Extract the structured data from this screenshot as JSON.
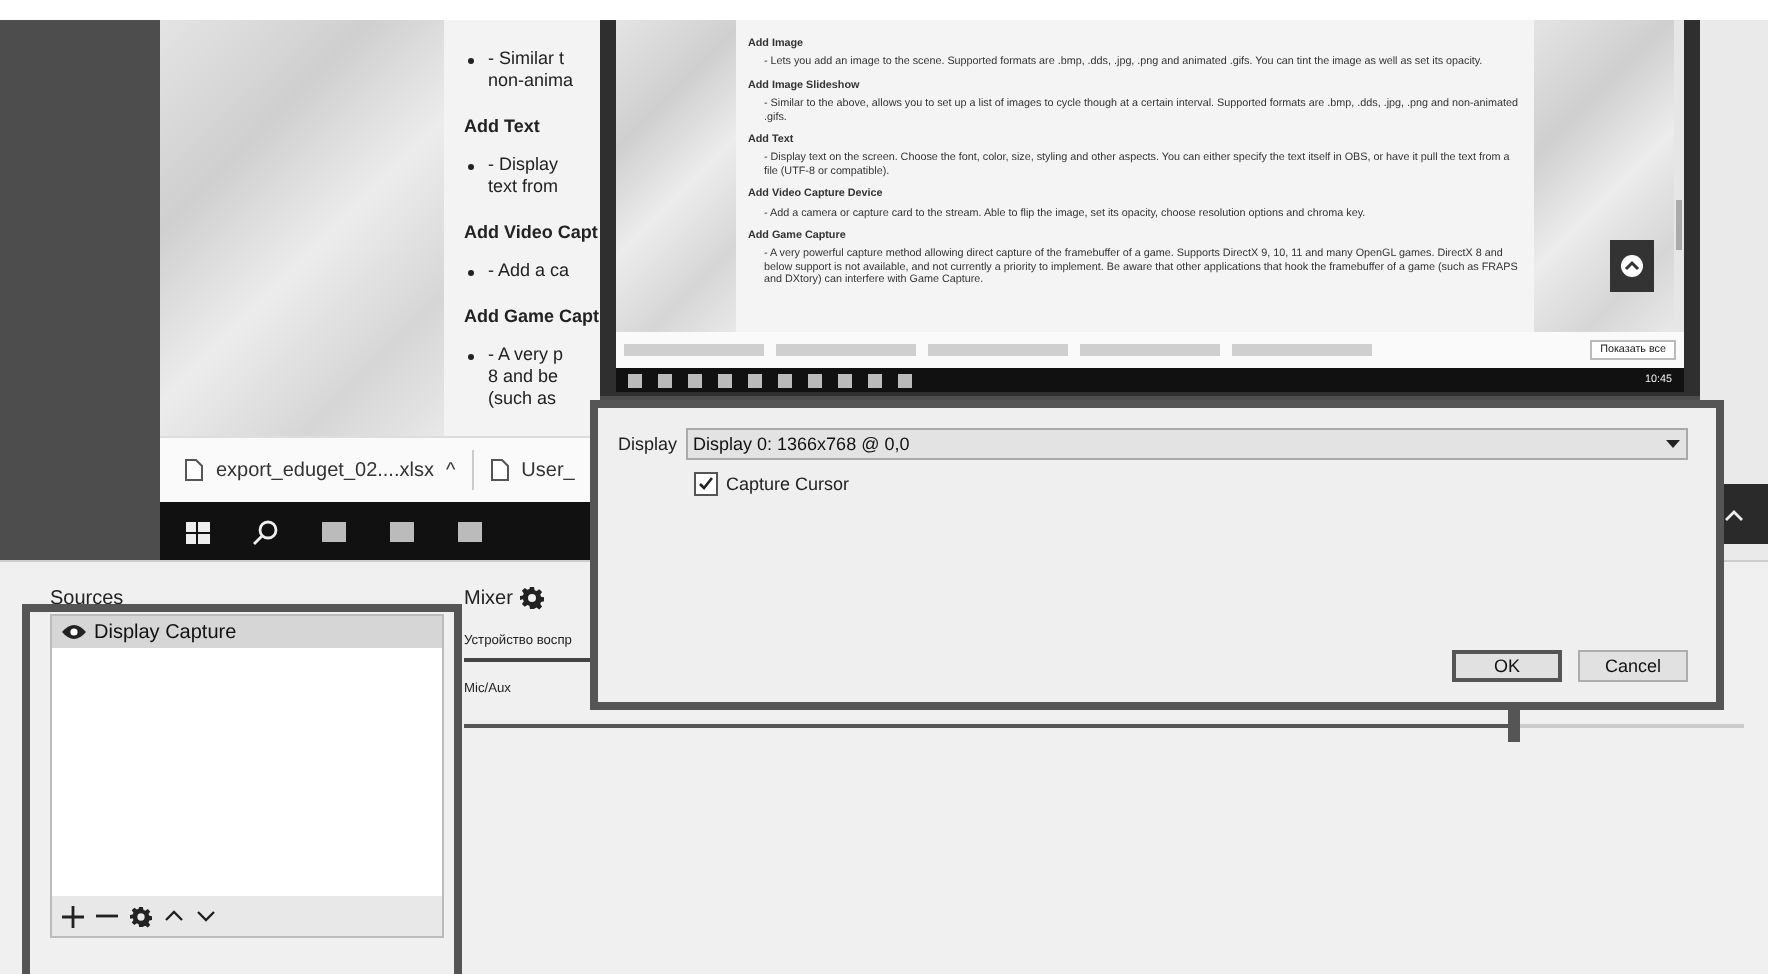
{
  "outer_page": {
    "lines": [
      {
        "kind": "bullet",
        "text": "- Similar t"
      },
      {
        "kind": "cont",
        "text": "non-anima"
      },
      {
        "kind": "heading",
        "text": "Add Text"
      },
      {
        "kind": "bullet",
        "text": "- Display"
      },
      {
        "kind": "cont",
        "text": "text from"
      },
      {
        "kind": "heading",
        "text": "Add Video Capt"
      },
      {
        "kind": "bullet",
        "text": "- Add a ca"
      },
      {
        "kind": "heading",
        "text": "Add Game Capt"
      },
      {
        "kind": "bullet",
        "text": "- A very p"
      },
      {
        "kind": "cont",
        "text": "8 and be"
      },
      {
        "kind": "cont",
        "text": "(such as"
      }
    ]
  },
  "outer_downloads": [
    {
      "name": "export_eduget_02....xlsx",
      "caret": "^"
    },
    {
      "name": "User_"
    }
  ],
  "preview_page": {
    "sections": [
      {
        "heading": "Add Image",
        "text": "- Lets you add an image to the scene. Supported formats are .bmp, .dds, .jpg, .png and animated .gifs. You can tint the image as well as set its opacity."
      },
      {
        "heading": "Add Image Slideshow",
        "text": "- Similar to the above, allows you to set up a list of images to cycle though at a certain interval. Supported formats are .bmp, .dds, .jpg, .png and non-animated .gifs."
      },
      {
        "heading": "Add Text",
        "text": "- Display text on the screen. Choose the font, color, size, styling and other aspects. You can either specify the text itself in OBS, or have it pull the text from a file (UTF-8 or compatible)."
      },
      {
        "heading": "Add Video Capture Device",
        "text": "- Add a camera or capture card to the stream. Able to flip the image, set its opacity, choose resolution options and chroma key."
      },
      {
        "heading": "Add Game Capture",
        "text": "- A very powerful capture method allowing direct capture of the framebuffer of a game. Supports DirectX 9, 10, 11 and many OpenGL games. DirectX 8 and below support is not available, and not currently a priority to implement. Be aware that other applications that hook the framebuffer of a game (such as FRAPS and DXtory) can interfere with Game Capture."
      }
    ],
    "show_all": "Показать все",
    "clock": "10:45"
  },
  "dialog": {
    "display_label": "Display",
    "display_value": "Display 0: 1366x768 @ 0,0",
    "capture_cursor": {
      "label": "Capture Cursor",
      "checked": true
    },
    "buttons": [
      {
        "label": "OK",
        "default": true
      },
      {
        "label": "Cancel",
        "default": false
      }
    ]
  },
  "sources": {
    "title": "Sources",
    "items": [
      {
        "name": "Display Capture",
        "selected": true,
        "visible": true
      }
    ]
  },
  "mixer": {
    "title": "Mixer",
    "channels": [
      {
        "name": "Устройство воспр"
      },
      {
        "name": "Mic/Aux",
        "level": 0.82
      }
    ]
  }
}
